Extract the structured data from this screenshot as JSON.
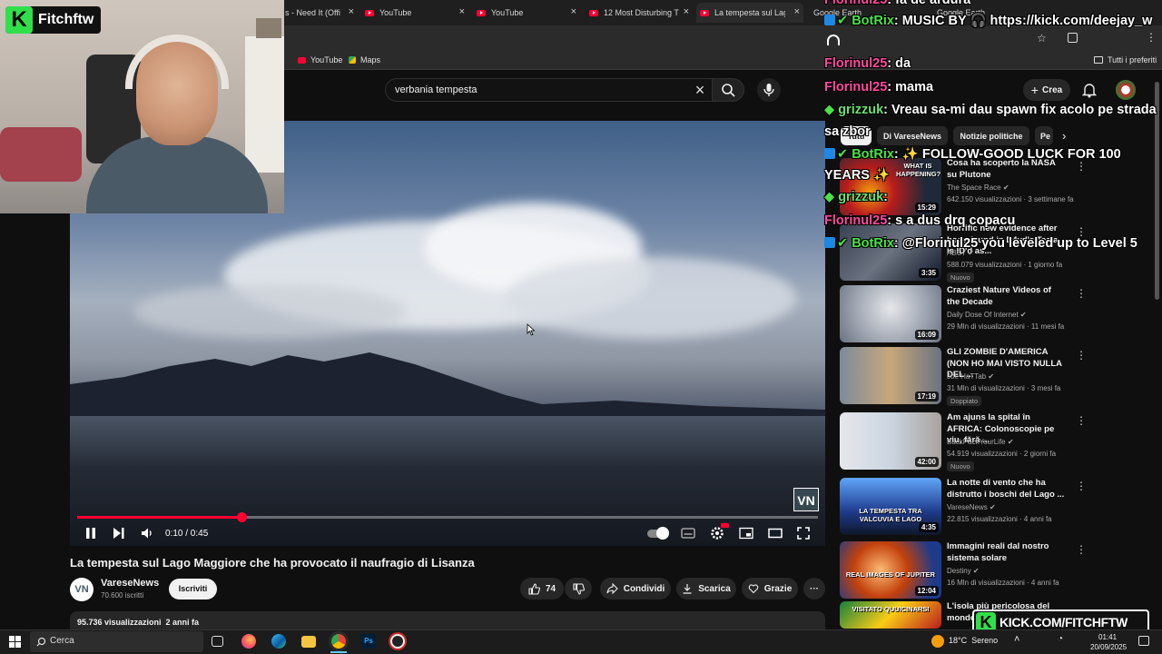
{
  "browser": {
    "tabs": [
      {
        "label": "s - Need It (Offi",
        "active": false
      },
      {
        "label": "YouTube",
        "active": false
      },
      {
        "label": "YouTube",
        "active": false
      },
      {
        "label": "12 Most Disturbing T",
        "active": false
      },
      {
        "label": "La tempesta sul Lago",
        "active": true
      },
      {
        "label": "Google Earth",
        "active": false
      },
      {
        "label": "Google Earth",
        "active": false
      }
    ],
    "bookmarks": [
      "YouTube",
      "Maps"
    ],
    "all_bookmarks_label": "Tutti i preferiti"
  },
  "header": {
    "search_value": "verbania tempesta",
    "create_label": "Crea"
  },
  "player": {
    "time": "0:10 / 0:45",
    "progress_fraction": 0.222,
    "watermark": "VN"
  },
  "video": {
    "title": "La tempesta sul Lago Maggiore che ha provocato il naufragio di Lisanza",
    "channel_avatar": "VN",
    "channel": "VareseNews",
    "subscribers": "70.600 iscritti",
    "subscribe_label": "Iscriviti",
    "likes": "74",
    "share_label": "Condividi",
    "download_label": "Scarica",
    "thanks_label": "Grazie",
    "description_meta": "95.736 visualizzazioni  2 anni fa"
  },
  "sidebar": {
    "chips": [
      "Tutti",
      "Di VareseNews",
      "Notizie politiche",
      "Pe"
    ],
    "recommendations": [
      {
        "title": "Cosa ha scoperto la NASA su Plutone",
        "channel": "The Space Race",
        "meta": "642.150 visualizzazioni · 3 settimane fa",
        "duration": "15:29",
        "badge": ""
      },
      {
        "title": "Horrific new evidence after body found in D4vd's Tesla is ID'd as...",
        "channel": "ABC7",
        "meta": "588.079 visualizzazioni · 1 giorno fa",
        "duration": "3:35",
        "badge": "Nuovo"
      },
      {
        "title": "Craziest Nature Videos of the Decade",
        "channel": "Daily Dose Of Internet",
        "meta": "29 Mln di visualizzazioni · 11 mesi fa",
        "duration": "16:09",
        "badge": ""
      },
      {
        "title": "GLI ZOMBIE D'AMERICA (NON HO MAI VISTO NULLA DEL ...",
        "channel": "Joe HaTTab",
        "meta": "31 Mln di visualizzazioni · 3 mesi fa",
        "duration": "17:19",
        "badge": "Doppiato"
      },
      {
        "title": "Am ajuns la spital în AFRICA: Colonoscopie pe viu, fără ...",
        "channel": "BackPackYourLife",
        "meta": "54.919 visualizzazioni · 2 giorni fa",
        "duration": "42:00",
        "badge": "Nuovo"
      },
      {
        "title": "La notte di vento che ha distrutto i boschi del Lago ...",
        "channel": "VareseNews",
        "meta": "22.815 visualizzazioni · 4 anni fa",
        "duration": "4:35",
        "badge": ""
      },
      {
        "title": "Immagini reali dal nostro sistema solare",
        "channel": "Destiny",
        "meta": "16 Mln di visualizzazioni · 4 anni fa",
        "duration": "12:04",
        "badge": ""
      },
      {
        "title": "L'isola più pericolosa del mondo",
        "channel": "",
        "meta": "",
        "duration": "",
        "badge": ""
      }
    ],
    "thumb_texts": [
      "WHAT IS HAPPENING?",
      "LA TEMPESTA TRA VALCUVIA E LAGO",
      "REAL IMAGES OF JUPITER",
      "VISITATO QUUICINARSI"
    ]
  },
  "stream": {
    "streamer_logo": "Fitchftw",
    "kick_banner": "KICK.COM/FITCHFTW",
    "chat": [
      {
        "user": "Florinul25",
        "text": ": fa de ardura",
        "type": "flo"
      },
      {
        "user": "BotRix",
        "text": ": MUSIC BY 🎧 https://kick.com/deejay_w",
        "type": "bot"
      },
      {
        "user": "Florinul25",
        "text": ": da",
        "type": "flo"
      },
      {
        "user": "Florinul25",
        "text": ": mama",
        "type": "flo"
      },
      {
        "user": "grizzuk",
        "text": ": Vreau sa-mi dau spawn fix acolo pe strada",
        "type": "gri"
      },
      {
        "user": "",
        "text": "sa zbor",
        "type": "cont"
      },
      {
        "user": "BotRix",
        "text": ": ✨ FOLLOW-GOOD LUCK FOR 100",
        "type": "bot"
      },
      {
        "user": "",
        "text": "YEARS ✨",
        "type": "cont"
      },
      {
        "user": "grizzuk",
        "text": ":",
        "type": "gri"
      },
      {
        "user": "Florinul25",
        "text": ": s a dus drq copacu",
        "type": "flo"
      },
      {
        "user": "BotRix",
        "text": ": @Florinul25 you leveled up to Level 5",
        "type": "bot"
      }
    ]
  },
  "taskbar": {
    "search_label": "Cerca",
    "weather": "18°C  Sereno",
    "time": "01:41",
    "date": "20/09/2025"
  },
  "colors": {
    "accent": "#ff0033",
    "kick": "#2fe04a",
    "florinul": "#ff4aa0",
    "botrix": "#4be24b"
  }
}
